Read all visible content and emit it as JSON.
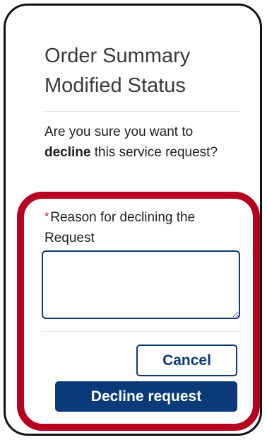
{
  "dialog": {
    "title_line1": "Order Summary",
    "title_line2": "Modified Status",
    "question_prefix": "Are you sure you want to ",
    "question_emphasis": "decline",
    "question_suffix": " this service request?"
  },
  "form": {
    "required_marker": "*",
    "reason_label": "Reason for declining the Request",
    "reason_value": ""
  },
  "actions": {
    "cancel_label": "Cancel",
    "decline_label": "Decline request"
  },
  "colors": {
    "primary": "#0b3a7a",
    "required": "#d0021b",
    "highlight": "#b8001f"
  }
}
